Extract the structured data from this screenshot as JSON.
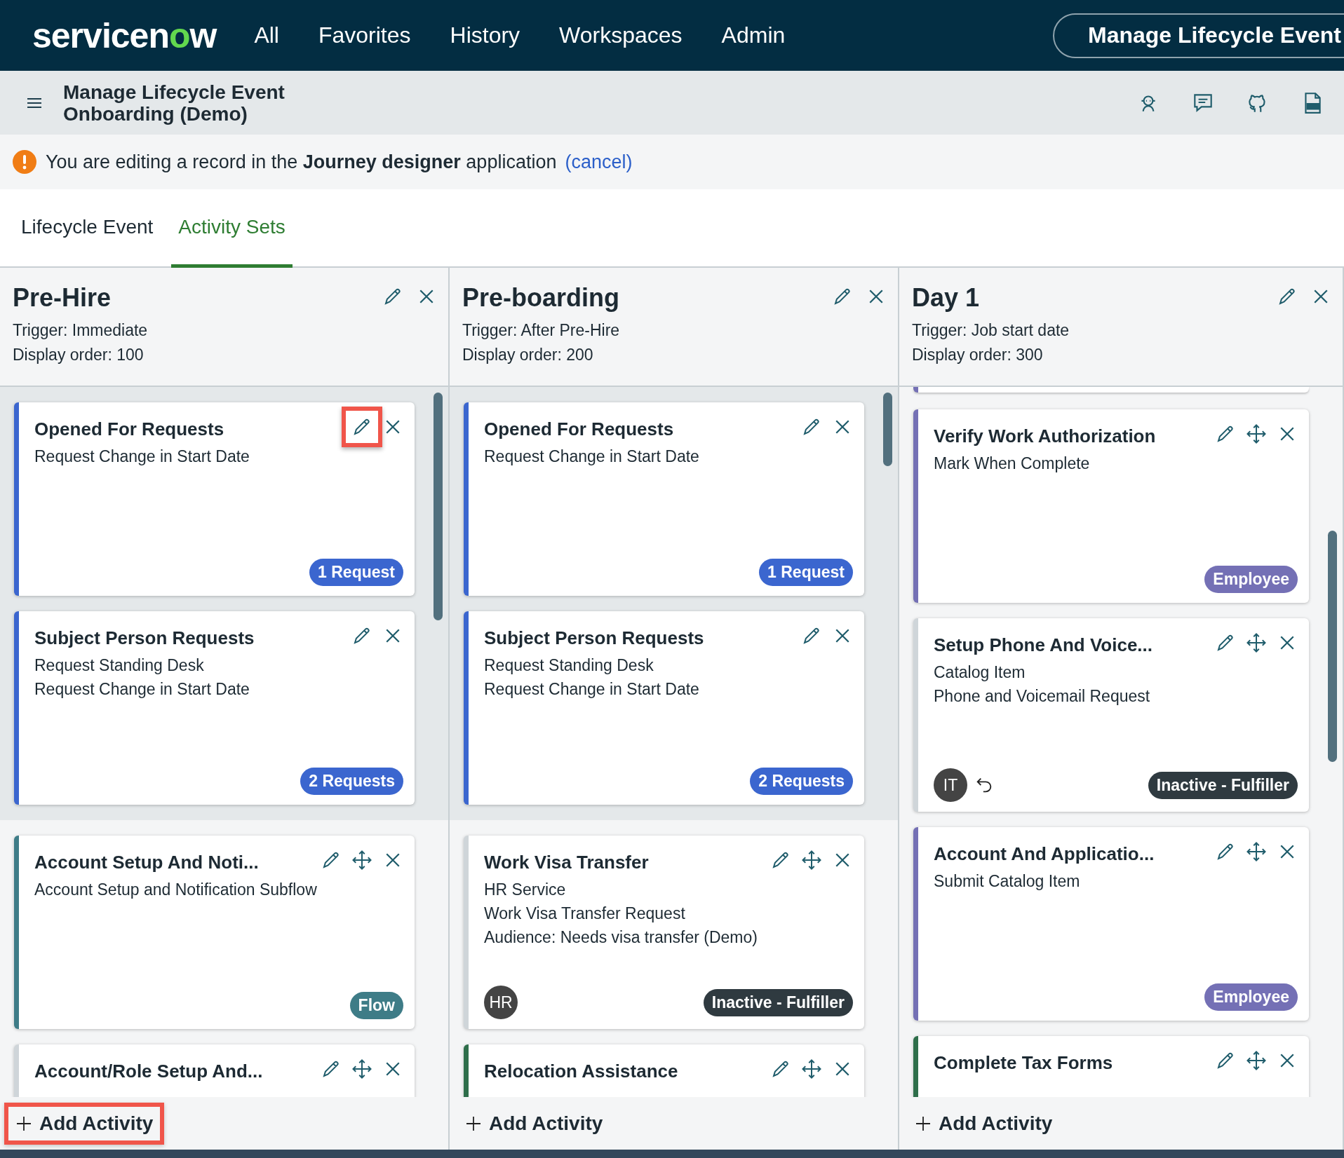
{
  "top_nav": {
    "logo_parts": [
      "servicen",
      "o",
      "w"
    ],
    "items": [
      "All",
      "Favorites",
      "History",
      "Workspaces",
      "Admin"
    ],
    "context_button": "Manage Lifecycle Event"
  },
  "record_header": {
    "title_lines": [
      "Manage Lifecycle Event",
      "Onboarding (Demo)"
    ]
  },
  "banner": {
    "message": "You are editing a record in the **Journey designer** application",
    "link": "(cancel)"
  },
  "tabs": [
    {
      "label": "Lifecycle Event",
      "selected": false
    },
    {
      "label": "Activity Sets",
      "selected": true
    }
  ],
  "columns": [
    {
      "title": "Pre-Hire",
      "trigger": "Trigger: Immediate",
      "display_order": "Display order: 100",
      "pinned_cards": [
        {
          "title": "Opened For Requests",
          "lines": [
            "Request Change in Start Date"
          ],
          "color": "#3b66cf",
          "movable": false,
          "edit_highlighted": true,
          "badge": {
            "text": "1 Request",
            "color": "#3b66cf"
          }
        },
        {
          "title": "Subject Person Requests",
          "lines": [
            "Request Standing Desk",
            "Request Change in Start Date"
          ],
          "color": "#3b66cf",
          "movable": false,
          "edit_highlighted": false,
          "badge": {
            "text": "2 Requests",
            "color": "#3b66cf"
          }
        }
      ],
      "cards": [
        {
          "title": "Account Setup And Noti...",
          "lines": [
            "Account Setup and Notification Subflow"
          ],
          "color": "#3e7c87",
          "movable": true,
          "edit_highlighted": false,
          "badge": {
            "text": "Flow",
            "color": "#3e7c87"
          }
        },
        {
          "title": "Account/Role Setup And...",
          "color": "#cfd5d9",
          "movable": true,
          "edit_highlighted": false
        }
      ],
      "add_label": "Add Activity",
      "add_highlighted": true
    },
    {
      "title": "Pre-boarding",
      "trigger": "Trigger: After Pre-Hire",
      "display_order": "Display order: 200",
      "pinned_cards": [
        {
          "title": "Opened For Requests",
          "lines": [
            "Request Change in Start Date"
          ],
          "color": "#3b66cf",
          "movable": false,
          "edit_highlighted": false,
          "badge": {
            "text": "1 Request",
            "color": "#3b66cf"
          }
        },
        {
          "title": "Subject Person Requests",
          "lines": [
            "Request Standing Desk",
            "Request Change in Start Date"
          ],
          "color": "#3b66cf",
          "movable": false,
          "edit_highlighted": false,
          "badge": {
            "text": "2 Requests",
            "color": "#3b66cf"
          }
        }
      ],
      "cards": [
        {
          "title": "Work Visa Transfer",
          "lines": [
            "HR Service",
            "Work Visa Transfer Request",
            "Audience: Needs visa transfer (Demo)"
          ],
          "color": "#cfd5d9",
          "movable": true,
          "edit_highlighted": false,
          "avatar": "HR",
          "badge": {
            "text": "Inactive - Fulfiller",
            "color": "#2f3a40"
          }
        },
        {
          "title": "Relocation Assistance",
          "color": "#2e6e4a",
          "movable": true,
          "edit_highlighted": false
        }
      ],
      "add_label": "Add Activity",
      "add_highlighted": false
    },
    {
      "title": "Day 1",
      "trigger": "Trigger: Job start date",
      "display_order": "Display order: 300",
      "card_above": {
        "color": "#7470b5"
      },
      "cards": [
        {
          "title": "Verify Work Authorization",
          "lines": [
            "Mark When Complete"
          ],
          "color": "#7470b5",
          "movable": true,
          "edit_highlighted": false,
          "badge": {
            "text": "Employee",
            "color": "#7470b5"
          }
        },
        {
          "title": "Setup Phone And Voice...",
          "lines": [
            "Catalog Item",
            "Phone and Voicemail Request"
          ],
          "color": "#cfd5d9",
          "movable": true,
          "edit_highlighted": false,
          "avatar": "IT",
          "revert_icon": true,
          "badge": {
            "text": "Inactive - Fulfiller",
            "color": "#2f3a40"
          }
        },
        {
          "title": "Account And Applicatio...",
          "lines": [
            "Submit Catalog Item"
          ],
          "color": "#7470b5",
          "movable": true,
          "edit_highlighted": false,
          "badge": {
            "text": "Employee",
            "color": "#7470b5"
          }
        },
        {
          "title": "Complete Tax Forms",
          "color": "#2e6e4a",
          "movable": true,
          "edit_highlighted": false
        }
      ],
      "add_label": "Add Activity",
      "add_highlighted": false
    }
  ]
}
